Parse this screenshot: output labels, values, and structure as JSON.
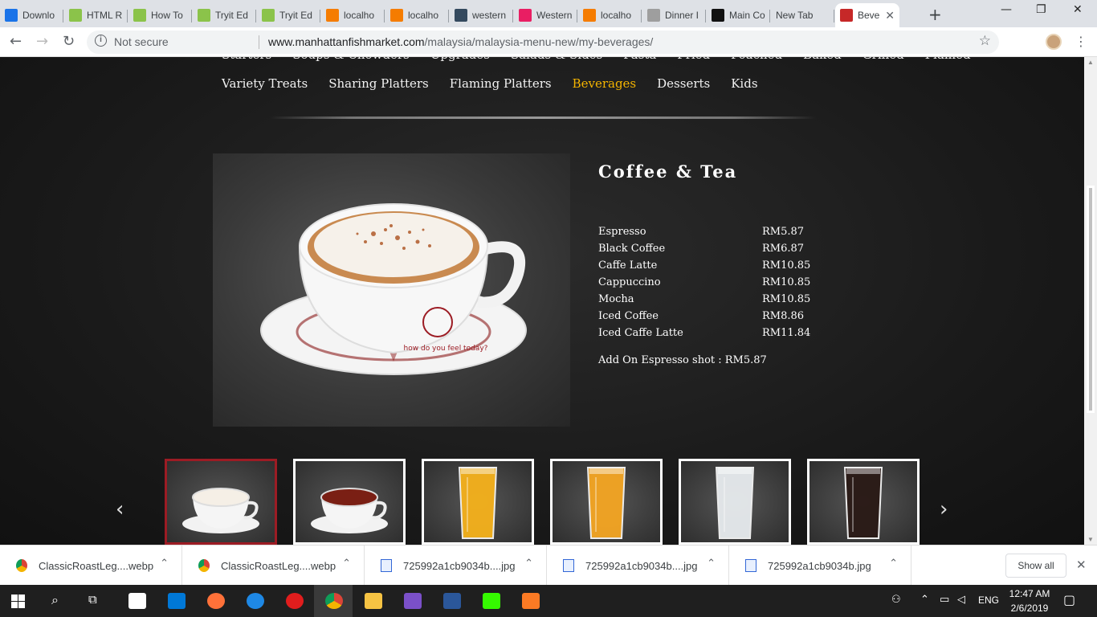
{
  "browser": {
    "tabs": [
      {
        "label": "Downlo",
        "icon": "download-icon",
        "color": "#1a73e8"
      },
      {
        "label": "HTML R",
        "icon": "w3schools-icon",
        "color": "#8bc34a"
      },
      {
        "label": "How To",
        "icon": "w3schools-icon",
        "color": "#8bc34a"
      },
      {
        "label": "Tryit Ed",
        "icon": "w3schools-icon",
        "color": "#8bc34a"
      },
      {
        "label": "Tryit Ed",
        "icon": "w3schools-icon",
        "color": "#8bc34a"
      },
      {
        "label": "localho",
        "icon": "xampp-icon",
        "color": "#f57c00"
      },
      {
        "label": "localho",
        "icon": "xampp-icon",
        "color": "#f57c00"
      },
      {
        "label": "western",
        "icon": "tripadvisor-icon",
        "color": "#34495e"
      },
      {
        "label": "Western",
        "icon": "google-play-icon",
        "color": "#e91e63"
      },
      {
        "label": "localho",
        "icon": "xampp-icon",
        "color": "#f57c00"
      },
      {
        "label": "Dinner I",
        "icon": "page-icon",
        "color": "#9e9e9e"
      },
      {
        "label": "Main Co",
        "icon": "s-icon",
        "color": "#111111"
      },
      {
        "label": "New Tab",
        "icon": "",
        "color": ""
      },
      {
        "label": "Beve",
        "icon": "fish-market-icon",
        "color": "#c62828"
      }
    ],
    "new_tab_symbol": "+",
    "window_controls": {
      "minimize": "—",
      "maximize": "❐",
      "close": "✕"
    },
    "security_label": "Not secure",
    "url_domain": "www.manhattanfishmarket.com",
    "url_path": "/malaysia/malaysia-menu-new/my-beverages/"
  },
  "page": {
    "categories_row1": [
      "Starters",
      "Soups & Chowders",
      "Upgrades",
      "Salads & Sides",
      "Pasta",
      "Fried",
      "Poached",
      "Baked",
      "Grilled",
      "Flamed"
    ],
    "categories_row2": [
      "Variety Treats",
      "Sharing Platters",
      "Flaming Platters",
      "Beverages",
      "Desserts",
      "Kids"
    ],
    "active_category": "Beverages",
    "section_title": "Coffee & Tea",
    "items": [
      {
        "name": "Espresso",
        "price": "RM5.87"
      },
      {
        "name": "Black Coffee",
        "price": "RM6.87"
      },
      {
        "name": "Caffe Latte",
        "price": "RM10.85"
      },
      {
        "name": "Cappuccino",
        "price": "RM10.85"
      },
      {
        "name": "Mocha",
        "price": "RM10.85"
      },
      {
        "name": "Iced Coffee",
        "price": "RM8.86"
      },
      {
        "name": "Iced Caffe Latte",
        "price": "RM11.84"
      }
    ],
    "addon": "Add On Espresso shot : RM5.87",
    "cup_logo_text": "how do you feel today?",
    "thumbnails": [
      {
        "name": "cappuccino",
        "liquid": "#f5efe6"
      },
      {
        "name": "tea",
        "liquid": "#7a1f14"
      },
      {
        "name": "orange-juice",
        "liquid": "#f6b21c"
      },
      {
        "name": "orange-juice-2",
        "liquid": "#f5a623"
      },
      {
        "name": "milk",
        "liquid": "#e8ecef"
      },
      {
        "name": "cola-float",
        "liquid": "#2a1a16"
      }
    ],
    "selected_thumbnail": 0,
    "prev_arrow": "‹",
    "next_arrow": "›"
  },
  "downloads": {
    "items": [
      {
        "name": "ClassicRoastLeg....webp",
        "type": "chrome"
      },
      {
        "name": "ClassicRoastLeg....webp",
        "type": "chrome"
      },
      {
        "name": "725992a1cb9034b....jpg",
        "type": "file"
      },
      {
        "name": "725992a1cb9034b....jpg",
        "type": "file"
      },
      {
        "name": "725992a1cb9034b.jpg",
        "type": "file"
      }
    ],
    "show_all": "Show all"
  },
  "taskbar": {
    "time": "12:47 AM",
    "date": "2/6/2019",
    "language": "ENG",
    "apps": [
      {
        "name": "mail",
        "color": "#ffffff"
      },
      {
        "name": "store",
        "color": "#0078d7"
      },
      {
        "name": "firefox",
        "color": "#ff7139"
      },
      {
        "name": "edge",
        "color": "#1e88e5"
      },
      {
        "name": "opera",
        "color": "#e11d1d"
      },
      {
        "name": "chrome",
        "color": "#fbbc04"
      },
      {
        "name": "explorer",
        "color": "#f6c343"
      },
      {
        "name": "visual-studio",
        "color": "#7b50c9"
      },
      {
        "name": "word",
        "color": "#2b579a"
      },
      {
        "name": "dreamweaver",
        "color": "#35fa00"
      },
      {
        "name": "xampp",
        "color": "#fb7a24"
      }
    ]
  }
}
